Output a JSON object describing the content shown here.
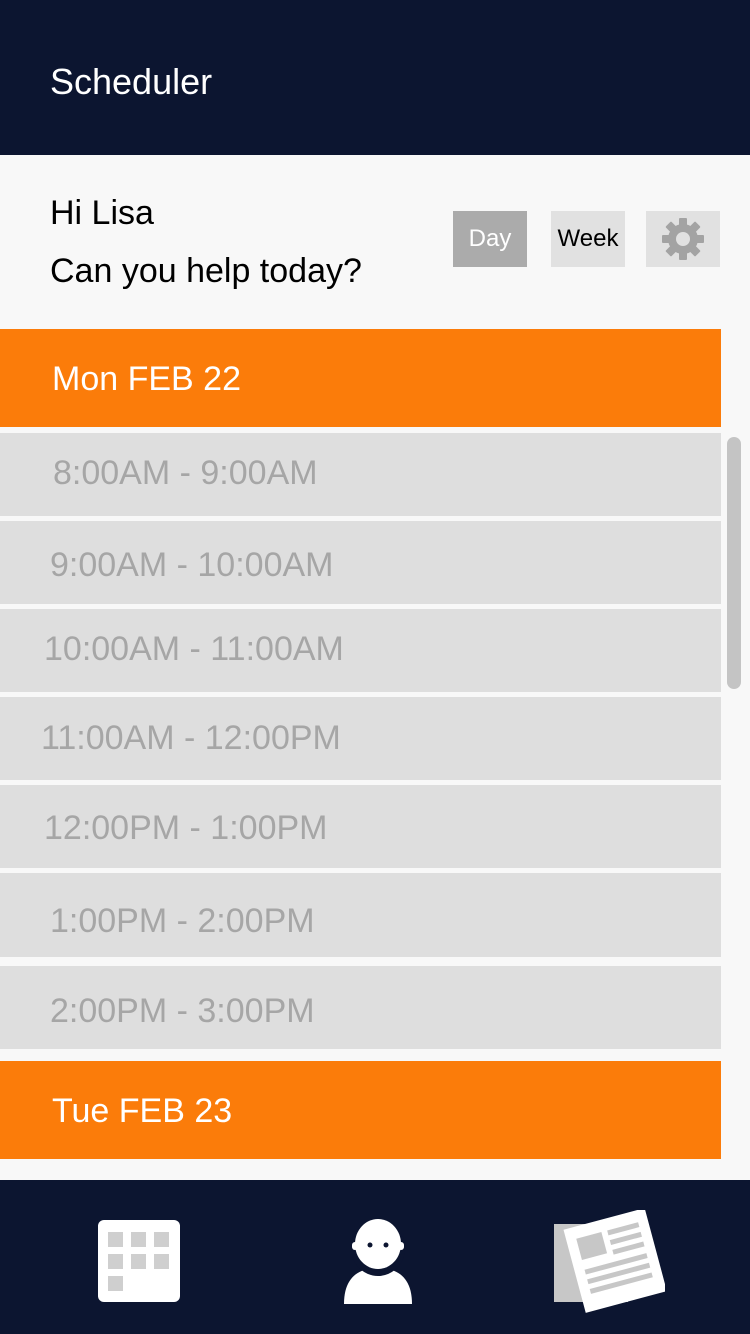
{
  "header": {
    "title": "Scheduler"
  },
  "greeting": {
    "line1": "Hi Lisa",
    "line2": "Can you help today?"
  },
  "view_toggle": {
    "day_label": "Day",
    "week_label": "Week",
    "settings_icon": "gear-icon",
    "selected": "Day"
  },
  "days": [
    {
      "label": "Mon FEB 22",
      "slots": [
        "8:00AM - 9:00AM",
        "9:00AM - 10:00AM",
        "10:00AM - 11:00AM",
        "11:00AM - 12:00PM",
        "12:00PM - 1:00PM",
        "1:00PM - 2:00PM",
        "2:00PM - 3:00PM"
      ]
    },
    {
      "label": "Tue FEB 23",
      "slots": []
    }
  ],
  "bottom_nav": {
    "items": [
      {
        "icon": "calendar-icon"
      },
      {
        "icon": "person-icon"
      },
      {
        "icon": "newspaper-icon"
      }
    ]
  },
  "colors": {
    "navy": "#0c1530",
    "accent_orange": "#fb7c0a",
    "slot_gray": "#dedede",
    "slot_text": "#a6a6a6",
    "day_button": "#ababab"
  }
}
